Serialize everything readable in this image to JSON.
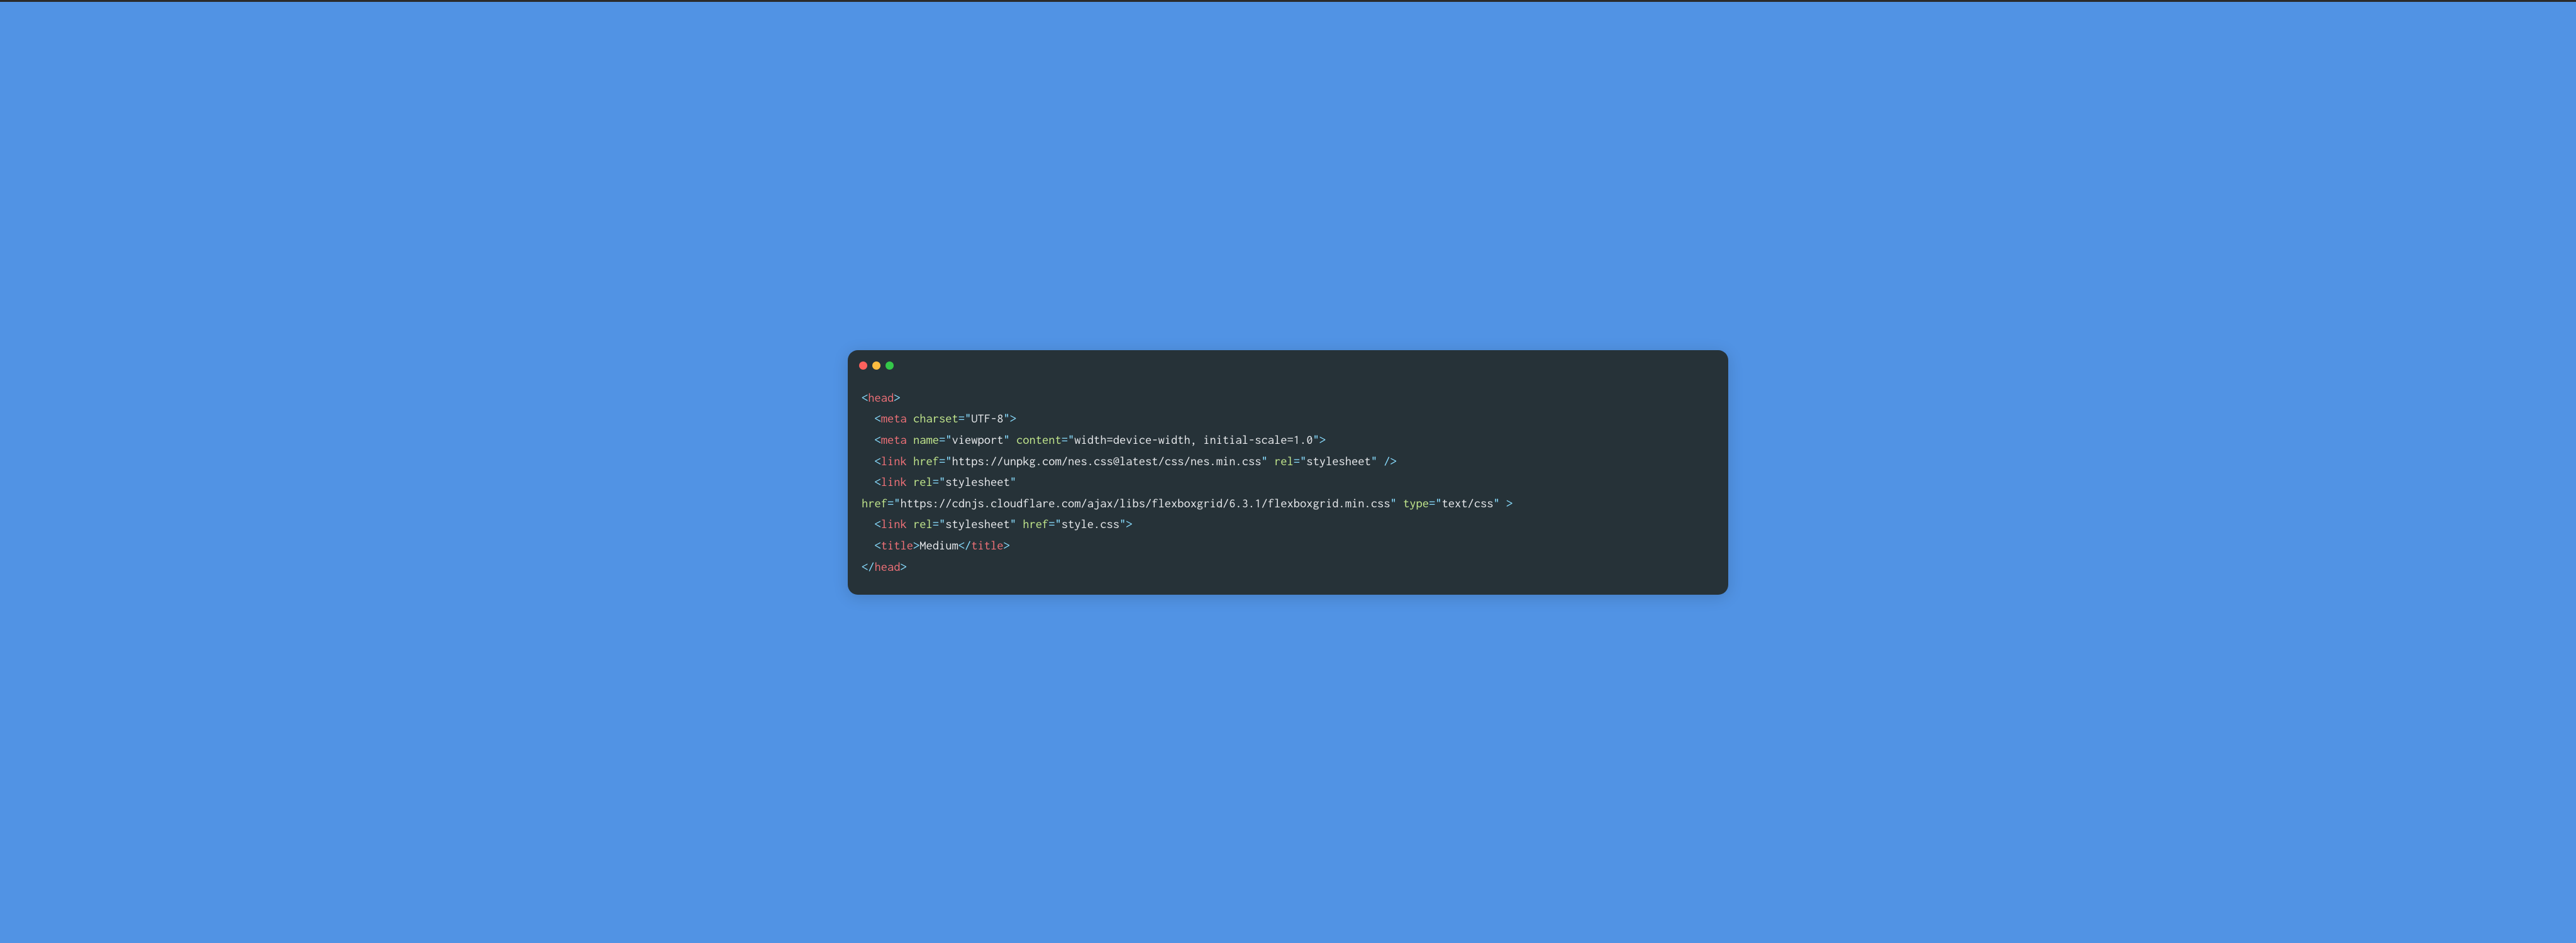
{
  "window": {
    "controls": {
      "red": "#fc615d",
      "yellow": "#fdbc40",
      "green": "#34c749"
    }
  },
  "code": {
    "line1": {
      "open": "<",
      "tag": "head",
      "close": ">"
    },
    "line2": {
      "indent": "  ",
      "open": "<",
      "tag": "meta",
      "sp1": " ",
      "attr1": "charset",
      "eq1": "=",
      "q1": "\"",
      "val1": "UTF-8",
      "q2": "\"",
      "close": ">"
    },
    "line3": {
      "indent": "  ",
      "open": "<",
      "tag": "meta",
      "sp1": " ",
      "attr1": "name",
      "eq1": "=",
      "q1": "\"",
      "val1": "viewport",
      "q2": "\"",
      "sp2": " ",
      "attr2": "content",
      "eq2": "=",
      "q3": "\"",
      "val2": "width=device-width, initial-scale=1.0",
      "q4": "\"",
      "close": ">"
    },
    "line4": {
      "indent": "  ",
      "open": "<",
      "tag": "link",
      "sp1": " ",
      "attr1": "href",
      "eq1": "=",
      "q1": "\"",
      "val1": "https://unpkg.com/nes.css@latest/css/nes.min.css",
      "q2": "\"",
      "sp2": " ",
      "attr2": "rel",
      "eq2": "=",
      "q3": "\"",
      "val2": "stylesheet",
      "q4": "\"",
      "sp3": " ",
      "close": "/>"
    },
    "line5": {
      "indent": "  ",
      "open": "<",
      "tag": "link",
      "sp1": " ",
      "attr1": "rel",
      "eq1": "=",
      "q1": "\"",
      "val1": "stylesheet",
      "q2": "\""
    },
    "line6": {
      "attr1": "href",
      "eq1": "=",
      "q1": "\"",
      "val1": "https://cdnjs.cloudflare.com/ajax/libs/flexboxgrid/6.3.1/flexboxgrid.min.css",
      "q2": "\"",
      "sp1": " ",
      "attr2": "type",
      "eq2": "=",
      "q3": "\"",
      "val2": "text/css",
      "q4": "\"",
      "sp2": " ",
      "close": ">"
    },
    "line7": {
      "indent": "  ",
      "open": "<",
      "tag": "link",
      "sp1": " ",
      "attr1": "rel",
      "eq1": "=",
      "q1": "\"",
      "val1": "stylesheet",
      "q2": "\"",
      "sp2": " ",
      "attr2": "href",
      "eq2": "=",
      "q3": "\"",
      "val2": "style.css",
      "q4": "\"",
      "close": ">"
    },
    "line8": {
      "indent": "  ",
      "open": "<",
      "tag": "title",
      "close1": ">",
      "text": "Medium",
      "open2": "</",
      "tag2": "title",
      "close2": ">"
    },
    "line9": {
      "open": "</",
      "tag": "head",
      "close": ">"
    }
  }
}
